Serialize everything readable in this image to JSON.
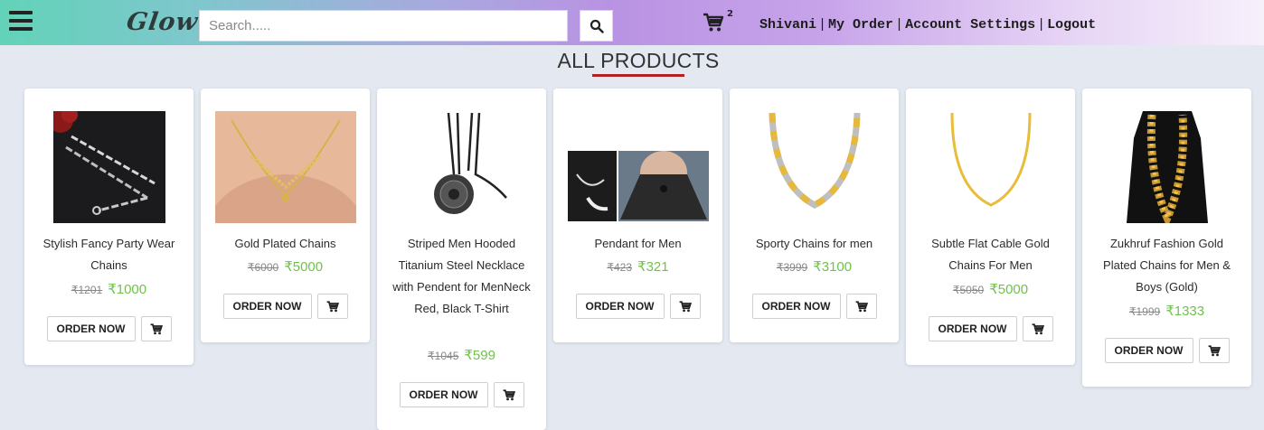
{
  "navbar": {
    "logo": "Glow",
    "search_placeholder": "Search.....",
    "cart_count": "2",
    "user_name": "Shivani",
    "my_order": "My Order",
    "account_settings": "Account Settings",
    "logout": "Logout",
    "separator": "|"
  },
  "heading": "ALL PRODUCTS",
  "currency": "₹",
  "order_label": "ORDER NOW",
  "colors": {
    "price_new": "#6fc24c",
    "underline": "#b22222",
    "background": "#e4e9f1"
  },
  "products": [
    {
      "name": "Stylish Fancy Party Wear Chains",
      "old_price": "₹1201",
      "new_price": "₹1000"
    },
    {
      "name": "Gold Plated Chains",
      "old_price": "₹6000",
      "new_price": "₹5000"
    },
    {
      "name": "Striped Men Hooded Titanium Steel Necklace with Pendent for MenNeck Red, Black T-Shirt",
      "old_price": "₹1045",
      "new_price": "₹599"
    },
    {
      "name": "Pendant for Men",
      "old_price": "₹423",
      "new_price": "₹321"
    },
    {
      "name": "Sporty Chains for men",
      "old_price": "₹3999",
      "new_price": "₹3100"
    },
    {
      "name": "Subtle Flat Cable Gold Chains For Men",
      "old_price": "₹5050",
      "new_price": "₹5000"
    },
    {
      "name": "Zukhruf Fashion Gold Plated Chains for Men & Boys (Gold)",
      "old_price": "₹1999",
      "new_price": "₹1333"
    }
  ]
}
